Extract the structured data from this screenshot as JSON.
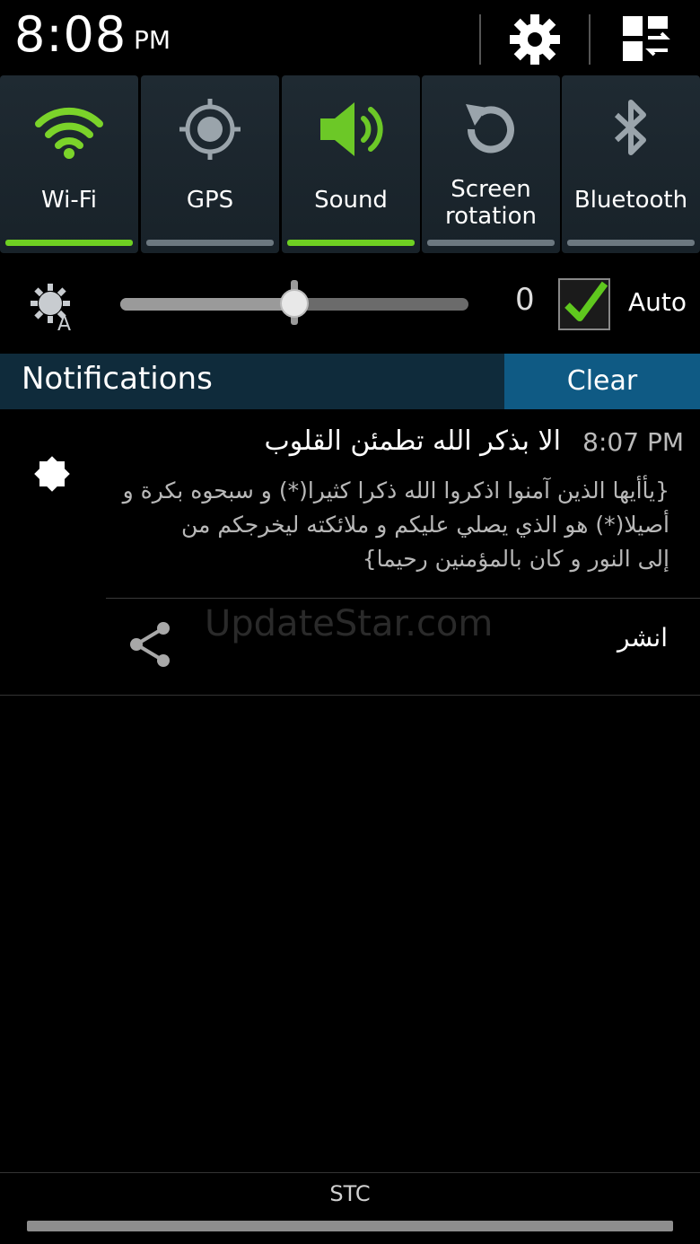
{
  "status_bar": {
    "time": "8:08",
    "ampm": "PM",
    "icons": [
      "gear-icon",
      "grid-toggle-icon"
    ]
  },
  "quick_settings": {
    "tiles": [
      {
        "label": "Wi-Fi",
        "icon": "wifi-icon",
        "on": true
      },
      {
        "label": "GPS",
        "icon": "gps-icon",
        "on": false
      },
      {
        "label": "Sound",
        "icon": "sound-icon",
        "on": true
      },
      {
        "label": "Screen rotation",
        "icon": "rotation-icon",
        "on": false
      },
      {
        "label": "Bluetooth",
        "icon": "bluetooth-icon",
        "on": false
      }
    ],
    "active_color": "#6ed022"
  },
  "brightness": {
    "icon": "auto-brightness-icon",
    "level": 0.5,
    "value": "0",
    "auto_label": "Auto",
    "auto_checked": true
  },
  "notifications": {
    "header": "Notifications",
    "clear_label": "Clear",
    "items": [
      {
        "icon": "star-badge-icon",
        "title": "الا بذكر الله تطمئن القلوب",
        "time": "8:07 PM",
        "lines": [
          "{يأأيها الذين آمنوا اذكروا الله ذكرا كثيرا(*) و سبحوه بكرة و",
          "أصيلا(*) هو الذي يصلي عليكم و ملائكته ليخرجكم من",
          "إلى النور و كان بالمؤمنين رحيما}"
        ],
        "action_label": "انشر",
        "action_icon": "share-icon"
      }
    ]
  },
  "watermark": "UpdateStar.com",
  "carrier": "STC"
}
